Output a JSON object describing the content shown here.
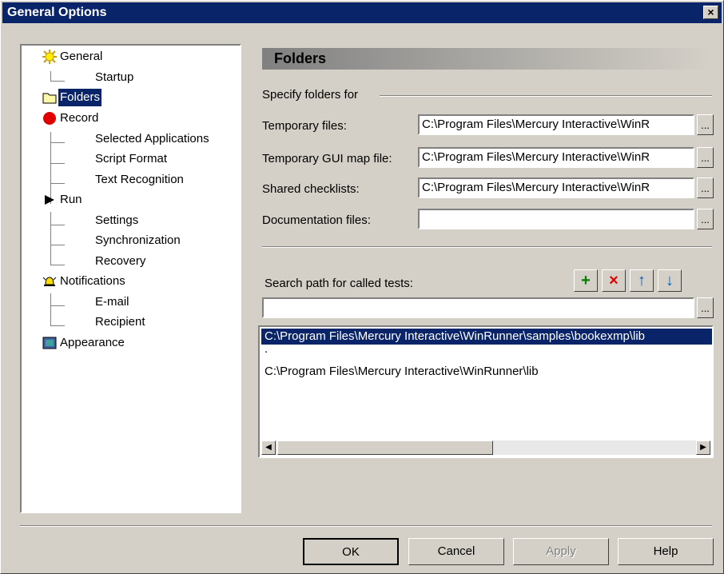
{
  "window": {
    "title": "General Options",
    "close_glyph": "×"
  },
  "tree": {
    "items": [
      {
        "label": "General",
        "icon": "sun-icon"
      },
      {
        "label": "Startup"
      },
      {
        "label": "Folders",
        "icon": "folder-icon"
      },
      {
        "label": "Record",
        "icon": "record-icon"
      },
      {
        "label": "Selected Applications"
      },
      {
        "label": "Script Format"
      },
      {
        "label": "Text Recognition"
      },
      {
        "label": "Run",
        "icon": "play-icon"
      },
      {
        "label": "Settings"
      },
      {
        "label": "Synchronization"
      },
      {
        "label": "Recovery"
      },
      {
        "label": "Notifications",
        "icon": "bell-icon"
      },
      {
        "label": "E-mail"
      },
      {
        "label": "Recipient"
      },
      {
        "label": "Appearance",
        "icon": "appearance-icon"
      }
    ]
  },
  "panel": {
    "header": "Folders",
    "specify_label": "Specify folders for",
    "fields": [
      {
        "label": "Temporary files:",
        "value": "C:\\Program Files\\Mercury Interactive\\WinR"
      },
      {
        "label": "Temporary GUI map file:",
        "value": "C:\\Program Files\\Mercury Interactive\\WinR"
      },
      {
        "label": "Shared checklists:",
        "value": "C:\\Program Files\\Mercury Interactive\\WinR"
      },
      {
        "label": "Documentation files:",
        "value": ""
      }
    ],
    "browse_label": "...",
    "search_label": "Search path for called tests:",
    "search_value": "",
    "toolbar": {
      "add": "+",
      "delete": "×",
      "up": "↑",
      "down": "↓"
    },
    "search_paths": [
      "C:\\Program Files\\Mercury Interactive\\WinRunner\\samples\\bookexmp\\lib",
      ".",
      "C:\\Program Files\\Mercury Interactive\\WinRunner\\lib"
    ]
  },
  "buttons": {
    "ok": "OK",
    "cancel": "Cancel",
    "apply": "Apply",
    "help": "Help"
  },
  "colors": {
    "titlebar": "#0a246a",
    "selection": "#0a246a",
    "face": "#d4d0c8"
  }
}
